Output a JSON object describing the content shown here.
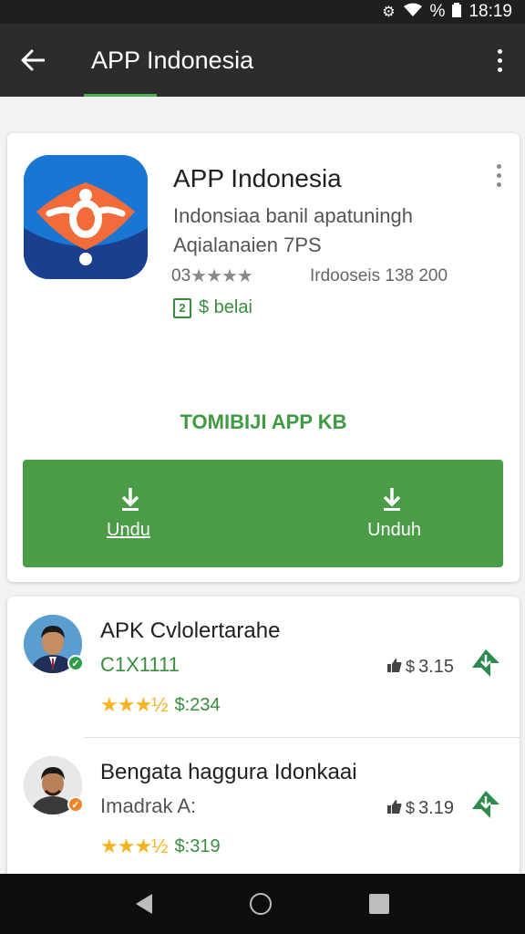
{
  "status_bar": {
    "time": "18:19",
    "battery_percent": "%",
    "icons": [
      "notification-icon",
      "wifi-icon",
      "battery-icon"
    ]
  },
  "app_bar": {
    "title": "APP Indonesia",
    "icons": [
      "back-arrow-icon",
      "more-vert-icon"
    ]
  },
  "app_card": {
    "name": "APP Indonesia",
    "description_line1": "Indonsiaa banil apatuningh",
    "description_line2": "Aqialanaien 7PS",
    "rating_text": "03",
    "rating_stars": 4,
    "downloads": "Irdooseis 138 200",
    "price_badge": "2",
    "price_text": "$ belai",
    "size_label": "TOMIBIJI APP KB",
    "install_left_label": "Undu",
    "install_right_label": "Unduh",
    "colors": {
      "accent_green": "#4a9c46",
      "icon_blue": "#1565c0",
      "icon_orange": "#f26b3a"
    }
  },
  "list": {
    "items": [
      {
        "title": "APK Cvlolertarahe",
        "subtitle": "C1X1111",
        "stars": 3.5,
        "price": "$:234",
        "meta": "3.15",
        "badge": "verified-green"
      },
      {
        "title": "Bengata haggura Idonkaai",
        "subtitle": "Imadrak A:",
        "stars": 3.5,
        "price": "$:319",
        "meta": "3.19",
        "badge": "verified-orange"
      }
    ]
  },
  "nav_bar": {
    "icons": [
      "nav-back-icon",
      "nav-home-icon",
      "nav-recents-icon"
    ]
  }
}
